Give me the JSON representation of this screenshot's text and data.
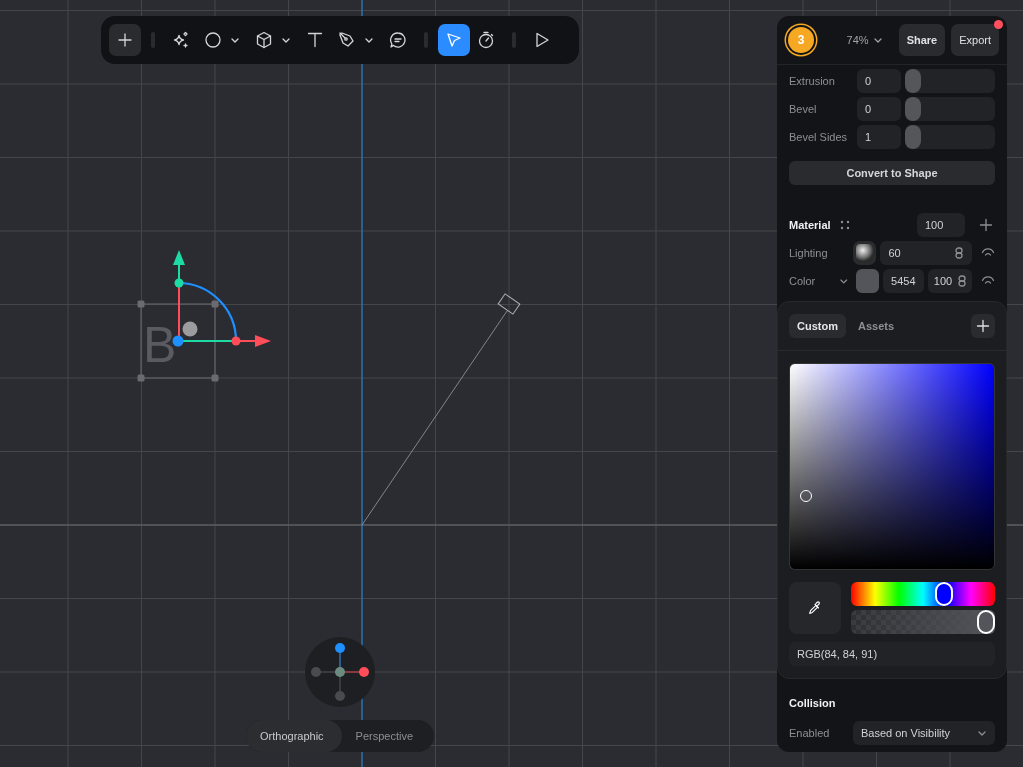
{
  "toolbar": {
    "items": [
      {
        "kind": "add",
        "selected": false
      },
      {
        "kind": "separator"
      },
      {
        "kind": "tool",
        "selected": false,
        "menu": false
      },
      {
        "kind": "tool",
        "selected": false,
        "menu": true
      },
      {
        "kind": "tool",
        "selected": false,
        "menu": true
      },
      {
        "kind": "tool",
        "selected": false,
        "menu": false
      },
      {
        "kind": "tool",
        "selected": false,
        "menu": true
      },
      {
        "kind": "tool",
        "selected": false,
        "menu": false
      },
      {
        "kind": "separator"
      },
      {
        "kind": "tool",
        "selected": true,
        "menu": false
      },
      {
        "kind": "tool",
        "selected": false,
        "menu": false
      },
      {
        "kind": "separator"
      },
      {
        "kind": "tool",
        "selected": false,
        "menu": false
      }
    ]
  },
  "canvas": {
    "shape_letter": "B"
  },
  "view_modes": [
    {
      "label": "Orthographic",
      "selected": true
    },
    {
      "label": "Perspective",
      "selected": false
    }
  ],
  "panel": {
    "header": {
      "avatar": "3",
      "zoom": "74%",
      "buttons": [
        "Share",
        "Export"
      ],
      "notification": true
    },
    "geometry": [
      {
        "label": "Extrusion",
        "value": "0",
        "level": 0
      },
      {
        "label": "Bevel",
        "value": "0",
        "level": 0
      },
      {
        "label": "Bevel Sides",
        "value": "1",
        "level": 0
      }
    ],
    "convert_button": "Convert to Shape",
    "material": {
      "title": "Material",
      "value": "100",
      "lighting": {
        "label": "Lighting",
        "value": "60"
      },
      "color": {
        "label": "Color",
        "color": "#54545b",
        "hex": "5454",
        "opacity": "100"
      }
    },
    "color_picker": {
      "tabs": [
        {
          "label": "Custom",
          "selected": true
        },
        {
          "label": "Assets",
          "selected": false
        }
      ],
      "color": "#54545b",
      "alpha": {
        "level": 1
      },
      "value": "RGB(84, 84, 91)"
    },
    "collision": {
      "title": "Collision",
      "label": "Enabled",
      "value": "Based on Visibility"
    }
  }
}
